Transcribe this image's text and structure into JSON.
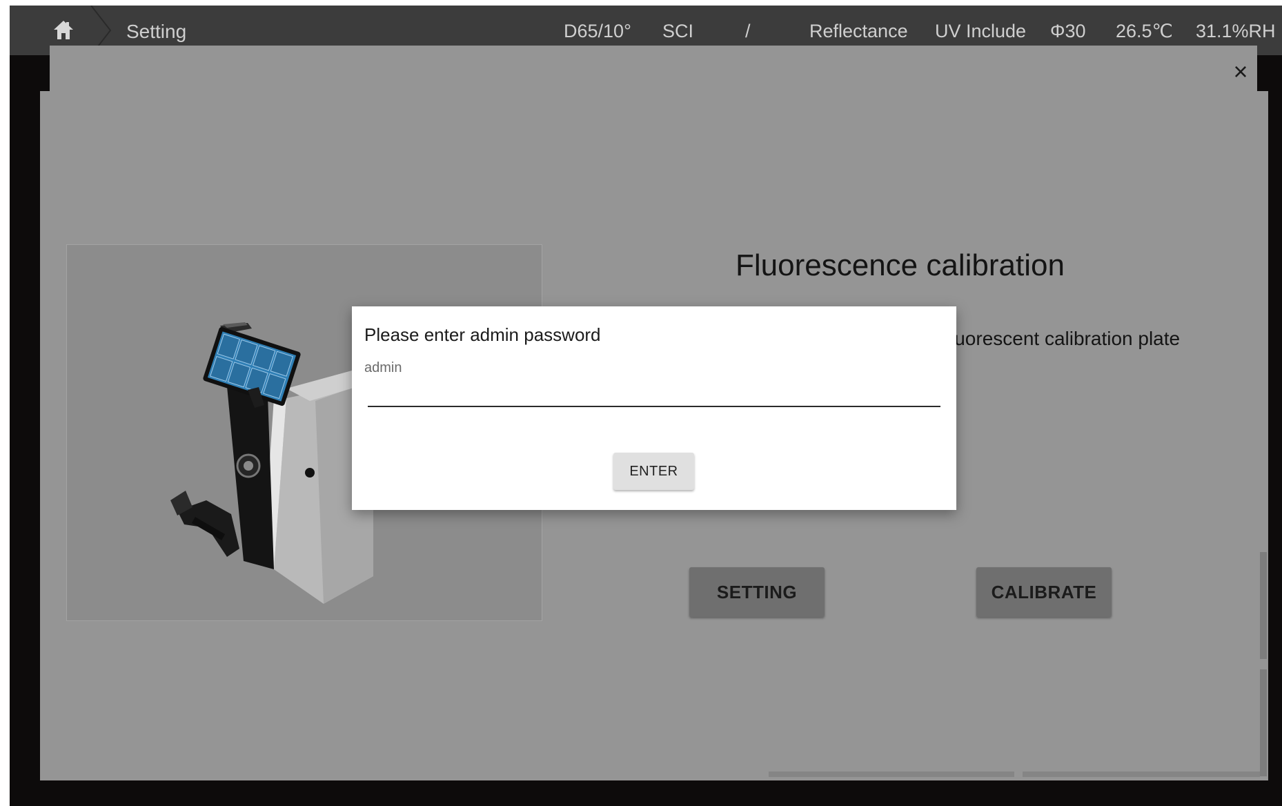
{
  "topbar": {
    "home_icon": "home-icon",
    "breadcrumb": "Setting",
    "status": {
      "illuminant": "D65/10°",
      "mode": "SCI",
      "separator": "/",
      "measurement": "Reflectance",
      "uv": "UV Include",
      "aperture": "Φ30",
      "temperature": "26.5℃",
      "humidity": "31.1%RH"
    }
  },
  "panel": {
    "close_label": "×",
    "title": "Fluorescence calibration",
    "description_visible": "luorescent calibration plate",
    "setting_label": "SETTING",
    "calibrate_label": "CALIBRATE"
  },
  "dialog": {
    "title": "Please enter admin password",
    "hint": "admin",
    "password_value": "",
    "enter_label": "ENTER"
  },
  "colors": {
    "topbar_bg": "#3c3c3c",
    "overlay_gray": "#959595",
    "screen_black": "#0d0b0b",
    "device_screen_blue": "#2f7fb5",
    "dialog_bg": "#ffffff"
  }
}
